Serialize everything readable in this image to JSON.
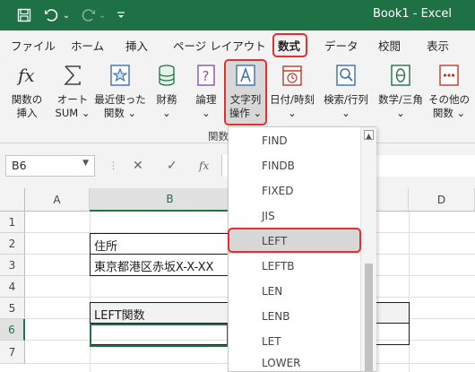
{
  "window": {
    "title": "Book1  -  Excel",
    "quick_access": {
      "save_icon": "save-icon",
      "undo_icon": "undo-icon",
      "undo_dropdown": "⌄",
      "redo_icon": "redo-icon",
      "redo_dropdown": "⌄",
      "customize_icon": "customize-quick-access-icon"
    }
  },
  "ribbon_tabs": [
    "ファイル",
    "ホーム",
    "挿入",
    "ページ レイアウト",
    "数式",
    "データ",
    "校閲",
    "表示"
  ],
  "active_tab": "数式",
  "ribbon": {
    "buttons": [
      {
        "label1": "関数の",
        "label2": "挿入",
        "icon": "fx-icon"
      },
      {
        "label1": "オート",
        "label2": "SUM ⌄",
        "icon": "sigma-icon"
      },
      {
        "label1": "最近使った",
        "label2": "関数 ⌄",
        "icon": "star-icon"
      },
      {
        "label1": "財務",
        "label2": "⌄",
        "icon": "database-icon"
      },
      {
        "label1": "論理",
        "label2": "⌄",
        "icon": "question-icon"
      },
      {
        "label1": "文字列",
        "label2": "操作 ⌄",
        "icon": "text-a-icon"
      },
      {
        "label1": "日付/時刻",
        "label2": "⌄",
        "icon": "clock-icon"
      },
      {
        "label1": "検索/行列",
        "label2": "⌄",
        "icon": "magnifier-icon"
      },
      {
        "label1": "数学/三角",
        "label2": "⌄",
        "icon": "theta-icon"
      },
      {
        "label1": "その他の",
        "label2": "関数 ⌄",
        "icon": "more-functions-icon"
      }
    ],
    "group_label": "関数"
  },
  "formula_bar": {
    "name_box": "B6",
    "name_box_arrow": "▼",
    "separator": "⋮",
    "cancel_icon": "✕",
    "enter_icon": "✓",
    "fx_label": "fx",
    "value": ""
  },
  "sheet": {
    "columns": [
      "A",
      "B",
      "D"
    ],
    "rows": [
      "1",
      "2",
      "3",
      "4",
      "5",
      "6",
      "7"
    ],
    "cells": {
      "B2": "住所",
      "B3": "東京都港区赤坂X-X-XX",
      "B5": "LEFT関数",
      "B6": ""
    },
    "active_cell": "B6"
  },
  "function_menu": {
    "items": [
      "FIND",
      "FINDB",
      "FIXED",
      "JIS",
      "LEFT",
      "LEFTB",
      "LEN",
      "LENB",
      "LET",
      "LOWER"
    ],
    "highlighted": "LEFT",
    "scroll_up": "▲"
  },
  "colors": {
    "titlebar": "#1e7145",
    "ribbon_bg": "#f3f3f3",
    "highlight_outline": "#e03131",
    "selection": "#217346"
  }
}
